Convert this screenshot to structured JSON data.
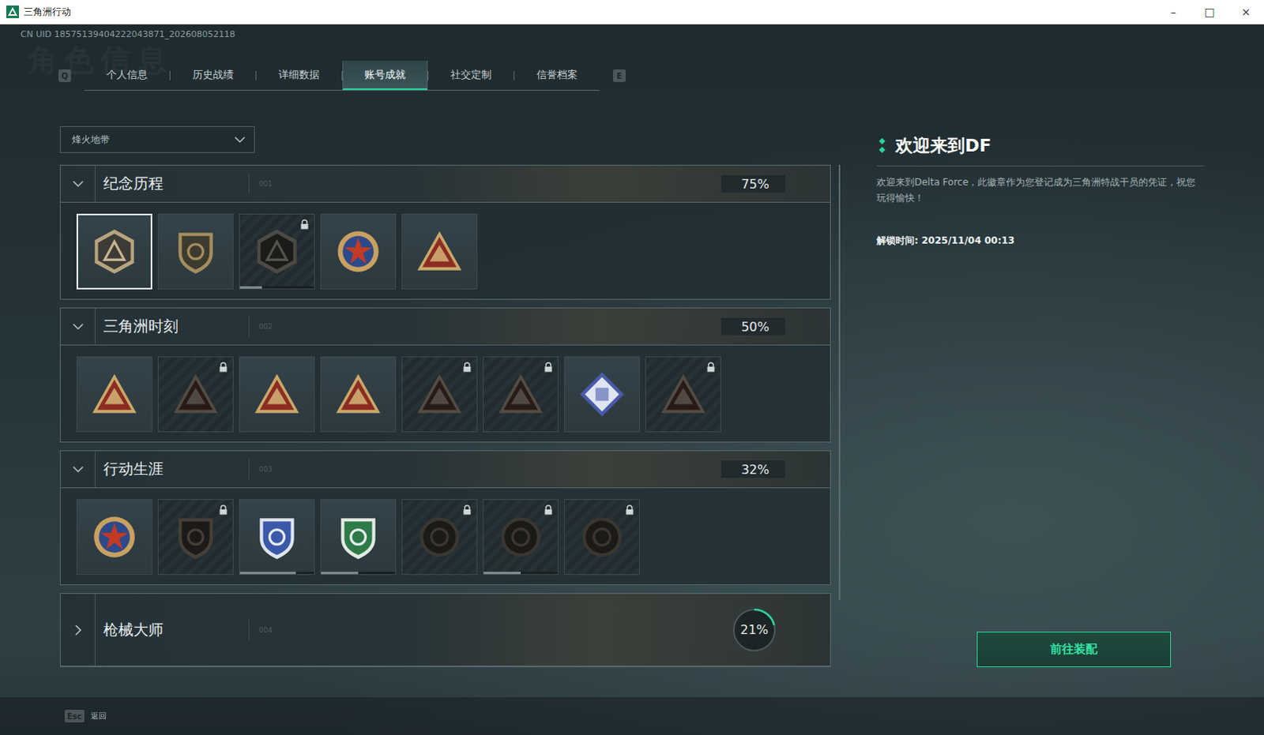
{
  "window": {
    "title": "三角洲行动",
    "controls": [
      "–",
      "□",
      "×"
    ]
  },
  "uid": "CN UID 18575139404222043871_202608052118",
  "watermark": "角色信息",
  "tabs": {
    "prev_key": "Q",
    "next_key": "E",
    "items": [
      {
        "label": "个人信息",
        "selected": false
      },
      {
        "label": "历史战绩",
        "selected": false
      },
      {
        "label": "详细数据",
        "selected": false
      },
      {
        "label": "账号成就",
        "selected": true
      },
      {
        "label": "社交定制",
        "selected": false
      },
      {
        "label": "信誉档案",
        "selected": false
      }
    ]
  },
  "mode_select": {
    "value": "烽火地带"
  },
  "sections": [
    {
      "title": "纪念历程",
      "index": "001",
      "percent": "75%",
      "expanded": true,
      "badges": [
        {
          "locked": false,
          "selected": true
        },
        {
          "locked": false,
          "selected": false
        },
        {
          "locked": true,
          "selected": false,
          "level": 0.3
        },
        {
          "locked": false,
          "selected": false
        },
        {
          "locked": false,
          "selected": false
        }
      ]
    },
    {
      "title": "三角洲时刻",
      "index": "002",
      "percent": "50%",
      "expanded": true,
      "badges": [
        {
          "locked": false,
          "selected": false
        },
        {
          "locked": true,
          "selected": false
        },
        {
          "locked": false,
          "selected": false
        },
        {
          "locked": false,
          "selected": false
        },
        {
          "locked": true,
          "selected": false
        },
        {
          "locked": true,
          "selected": false
        },
        {
          "locked": false,
          "selected": false
        },
        {
          "locked": true,
          "selected": false
        }
      ]
    },
    {
      "title": "行动生涯",
      "index": "003",
      "percent": "32%",
      "expanded": true,
      "badges": [
        {
          "locked": false,
          "selected": false
        },
        {
          "locked": true,
          "selected": false
        },
        {
          "locked": false,
          "selected": false,
          "level": 0.75
        },
        {
          "locked": false,
          "selected": false,
          "level": 0.5
        },
        {
          "locked": true,
          "selected": false
        },
        {
          "locked": true,
          "selected": false,
          "level": 0.5
        },
        {
          "locked": true,
          "selected": false
        }
      ]
    },
    {
      "title": "枪械大师",
      "index": "004",
      "percent": "21%",
      "expanded": false,
      "level": 0.21,
      "badges": []
    }
  ],
  "detail": {
    "title": "欢迎来到DF",
    "description": "欢迎来到Delta Force，此徽章作为您登记成为三角洲特战干员的凭证，祝您玩得愉快！",
    "unlock_time": "解锁时间: 2025/11/04 00:13",
    "button": "前往装配"
  },
  "footer": {
    "key": "Esc",
    "label": "返回"
  }
}
